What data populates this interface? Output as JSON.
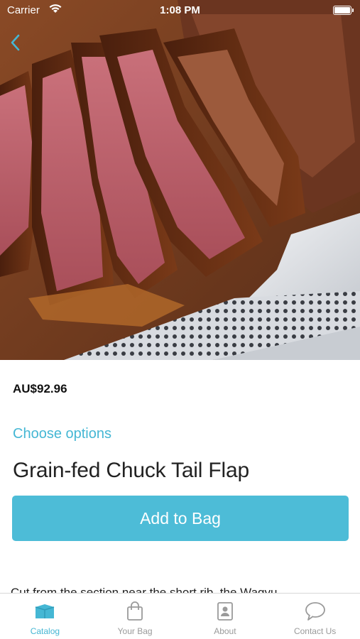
{
  "status_bar": {
    "carrier": "Carrier",
    "time": "1:08 PM"
  },
  "product": {
    "image_alt_icon": "steak-photo",
    "price": "AU$92.96",
    "choose_options": "Choose options",
    "title": "Grain-fed Chuck Tail Flap",
    "add_to_bag_label": "Add to Bag",
    "description": "Cut from the section near the short rib, the Wagyu"
  },
  "tab_bar": {
    "tabs": [
      {
        "label": "Catalog",
        "icon": "catalog-icon",
        "active": true
      },
      {
        "label": "Your Bag",
        "icon": "bag-icon",
        "active": false
      },
      {
        "label": "About",
        "icon": "about-icon",
        "active": false
      },
      {
        "label": "Contact Us",
        "icon": "chat-icon",
        "active": false
      }
    ]
  },
  "colors": {
    "accent": "#45b7d4",
    "button": "#4dbcd7",
    "inactive": "#9a9a9a"
  }
}
